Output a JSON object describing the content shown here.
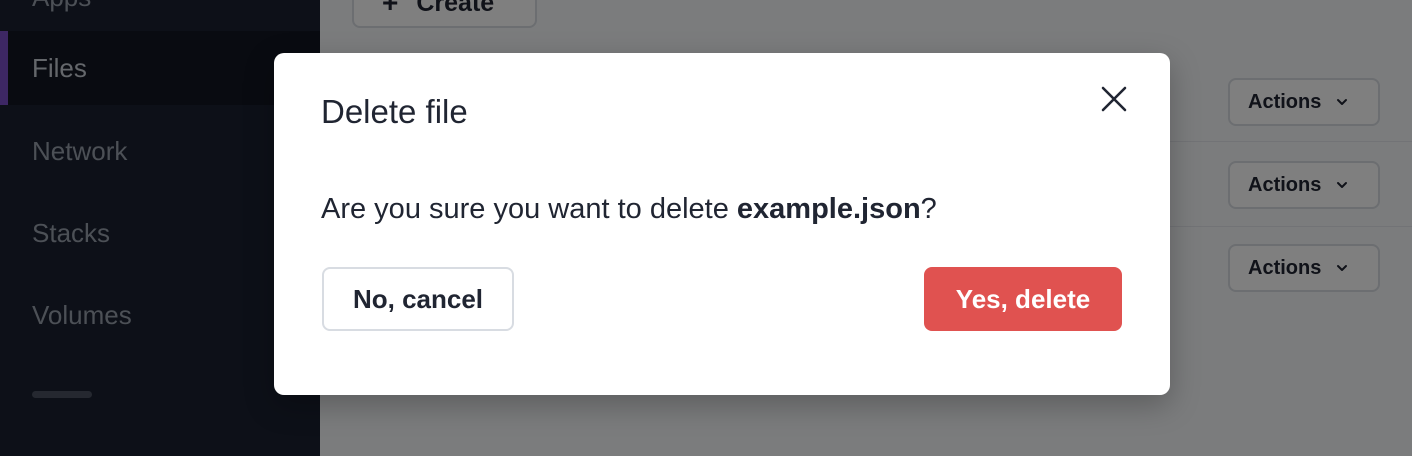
{
  "sidebar": {
    "partial_label": "Apps",
    "items": [
      {
        "label": "Files",
        "active": true
      },
      {
        "label": "Network",
        "active": false
      },
      {
        "label": "Stacks",
        "active": false
      },
      {
        "label": "Volumes",
        "active": false
      }
    ]
  },
  "toolbar": {
    "create_label": "Create"
  },
  "rows": [
    {
      "actions_label": "Actions"
    },
    {
      "actions_label": "Actions"
    },
    {
      "actions_label": "Actions"
    }
  ],
  "modal": {
    "title": "Delete file",
    "message_prefix": "Are you sure you want to delete ",
    "file_name": "example.json",
    "message_suffix": "?",
    "cancel_label": "No, cancel",
    "confirm_label": "Yes, delete"
  },
  "colors": {
    "sidebar_bg": "#1b2130",
    "active_indicator": "#7b4fc9",
    "danger": "#e05250"
  }
}
